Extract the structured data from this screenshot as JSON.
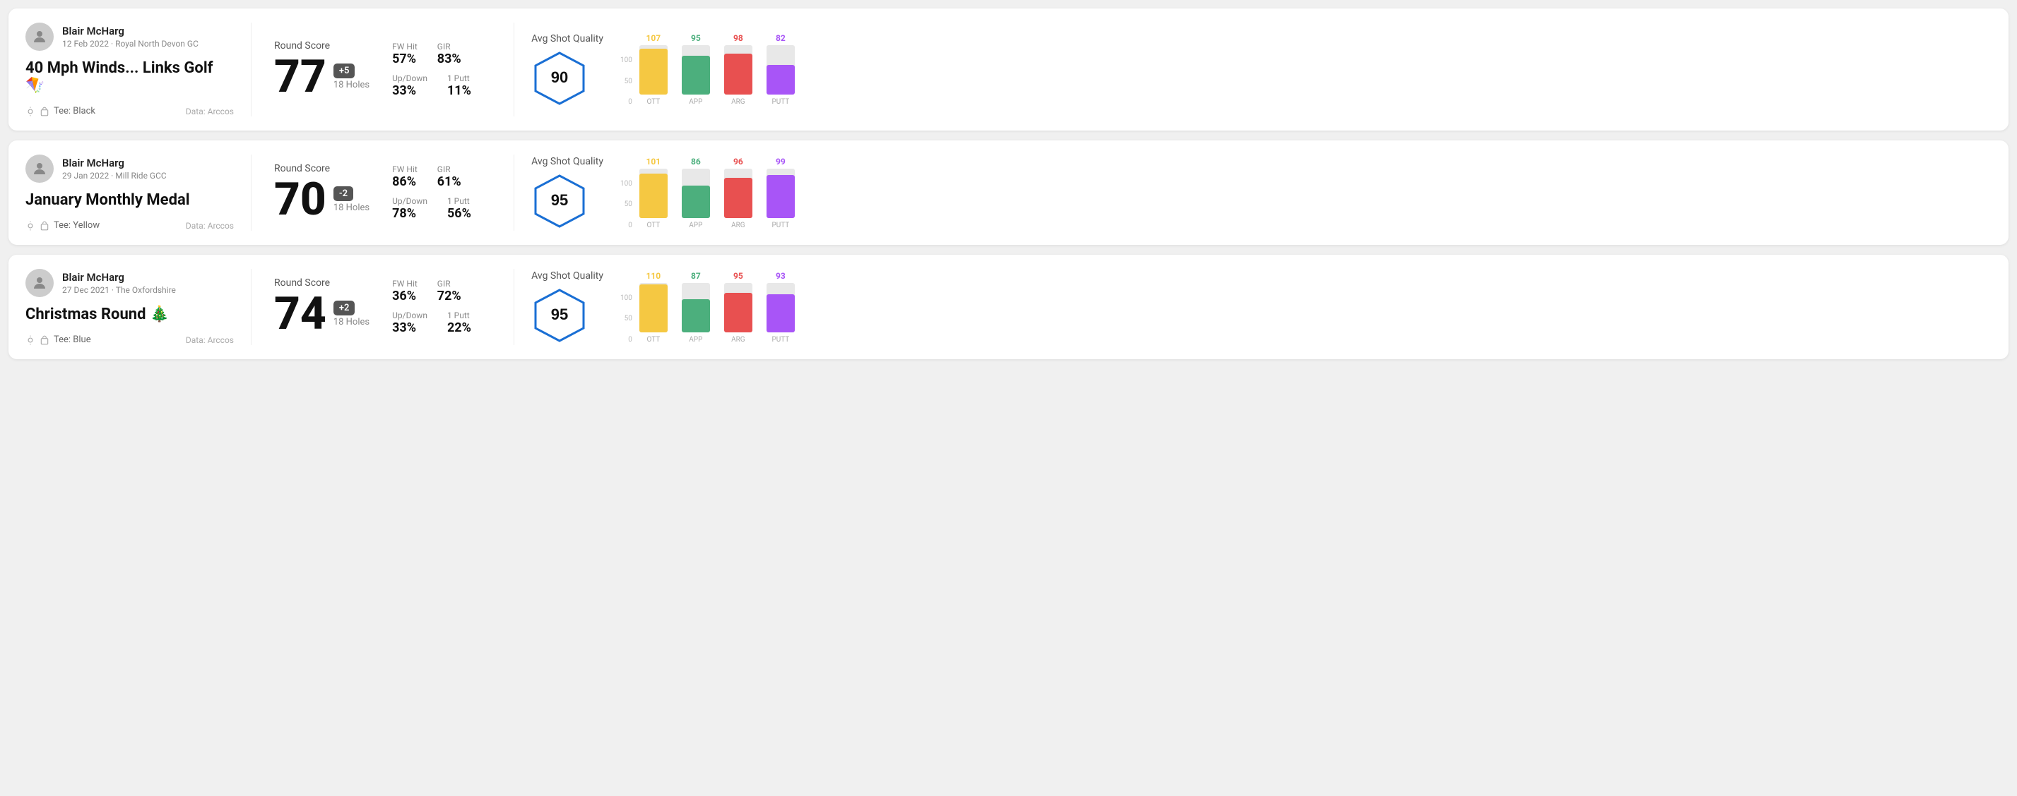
{
  "rounds": [
    {
      "id": "round1",
      "player": {
        "name": "Blair McHarg",
        "meta": "12 Feb 2022 · Royal North Devon GC"
      },
      "title": "40 Mph Winds... Links Golf 🪁",
      "tee": "Tee: Black",
      "dataSource": "Data: Arccos",
      "score": {
        "label": "Round Score",
        "number": "77",
        "badge": "+5",
        "holes": "18 Holes"
      },
      "stats": {
        "fwHit": {
          "label": "FW Hit",
          "value": "57%"
        },
        "gir": {
          "label": "GIR",
          "value": "83%"
        },
        "upDown": {
          "label": "Up/Down",
          "value": "33%"
        },
        "onePutt": {
          "label": "1 Putt",
          "value": "11%"
        }
      },
      "quality": {
        "label": "Avg Shot Quality",
        "score": "90"
      },
      "chart": {
        "bars": [
          {
            "label": "OTT",
            "value": 107,
            "color": "#f5c842",
            "height": 65
          },
          {
            "label": "APP",
            "value": 95,
            "color": "#4caf7d",
            "height": 55
          },
          {
            "label": "ARG",
            "value": 98,
            "color": "#e85050",
            "height": 58
          },
          {
            "label": "PUTT",
            "value": 82,
            "color": "#a855f7",
            "height": 42
          }
        ]
      }
    },
    {
      "id": "round2",
      "player": {
        "name": "Blair McHarg",
        "meta": "29 Jan 2022 · Mill Ride GCC"
      },
      "title": "January Monthly Medal",
      "tee": "Tee: Yellow",
      "dataSource": "Data: Arccos",
      "score": {
        "label": "Round Score",
        "number": "70",
        "badge": "-2",
        "holes": "18 Holes"
      },
      "stats": {
        "fwHit": {
          "label": "FW Hit",
          "value": "86%"
        },
        "gir": {
          "label": "GIR",
          "value": "61%"
        },
        "upDown": {
          "label": "Up/Down",
          "value": "78%"
        },
        "onePutt": {
          "label": "1 Putt",
          "value": "56%"
        }
      },
      "quality": {
        "label": "Avg Shot Quality",
        "score": "95"
      },
      "chart": {
        "bars": [
          {
            "label": "OTT",
            "value": 101,
            "color": "#f5c842",
            "height": 63
          },
          {
            "label": "APP",
            "value": 86,
            "color": "#4caf7d",
            "height": 46
          },
          {
            "label": "ARG",
            "value": 96,
            "color": "#e85050",
            "height": 57
          },
          {
            "label": "PUTT",
            "value": 99,
            "color": "#a855f7",
            "height": 61
          }
        ]
      }
    },
    {
      "id": "round3",
      "player": {
        "name": "Blair McHarg",
        "meta": "27 Dec 2021 · The Oxfordshire"
      },
      "title": "Christmas Round 🎄",
      "tee": "Tee: Blue",
      "dataSource": "Data: Arccos",
      "score": {
        "label": "Round Score",
        "number": "74",
        "badge": "+2",
        "holes": "18 Holes"
      },
      "stats": {
        "fwHit": {
          "label": "FW Hit",
          "value": "36%"
        },
        "gir": {
          "label": "GIR",
          "value": "72%"
        },
        "upDown": {
          "label": "Up/Down",
          "value": "33%"
        },
        "onePutt": {
          "label": "1 Putt",
          "value": "22%"
        }
      },
      "quality": {
        "label": "Avg Shot Quality",
        "score": "95"
      },
      "chart": {
        "bars": [
          {
            "label": "OTT",
            "value": 110,
            "color": "#f5c842",
            "height": 68
          },
          {
            "label": "APP",
            "value": 87,
            "color": "#4caf7d",
            "height": 47
          },
          {
            "label": "ARG",
            "value": 95,
            "color": "#e85050",
            "height": 56
          },
          {
            "label": "PUTT",
            "value": 93,
            "color": "#a855f7",
            "height": 54
          }
        ]
      }
    }
  ],
  "chart": {
    "yLabels": [
      "100",
      "50",
      "0"
    ]
  }
}
